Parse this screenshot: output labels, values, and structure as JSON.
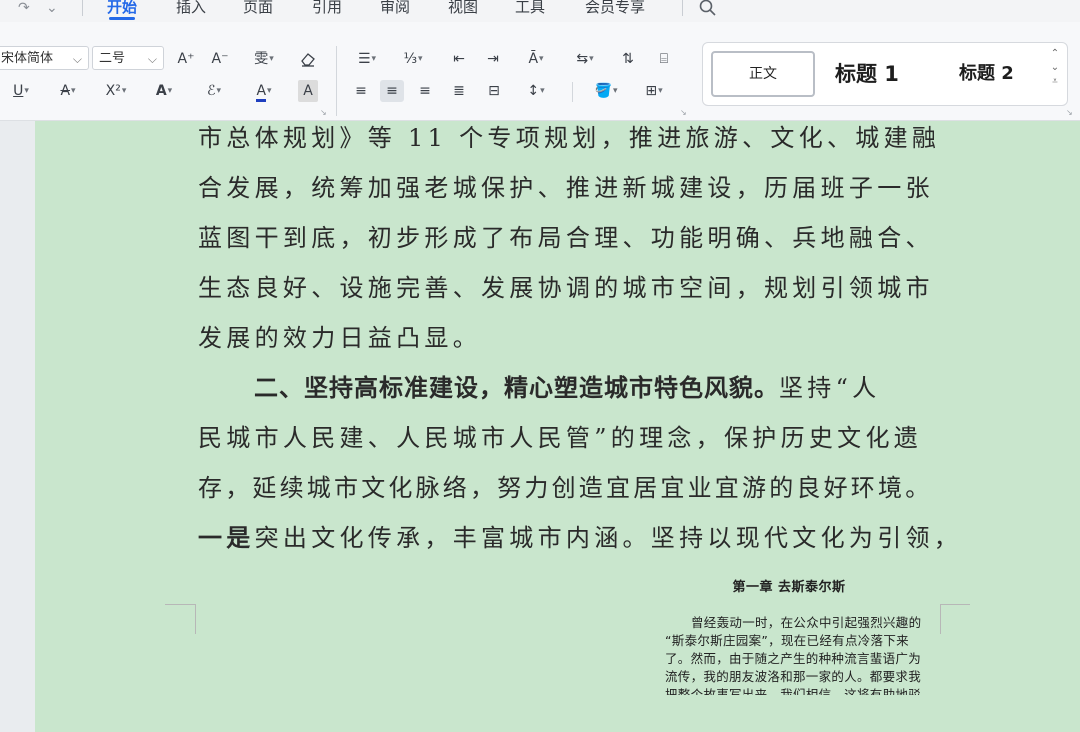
{
  "menubar": {
    "quick_access": [
      "↷",
      "⌄"
    ],
    "tabs": [
      {
        "label": "开始",
        "active": true
      },
      {
        "label": "插入"
      },
      {
        "label": "页面"
      },
      {
        "label": "引用"
      },
      {
        "label": "审阅"
      },
      {
        "label": "视图"
      },
      {
        "label": "工具"
      },
      {
        "label": "会员专享"
      }
    ]
  },
  "ribbon": {
    "font_name": "宋体简体",
    "font_size": "二号",
    "row1": {
      "grow_font": "A⁺",
      "shrink_font": "A⁻",
      "phonetic": "a̐",
      "clear_format": "⌫"
    },
    "styles": {
      "normal": "正文",
      "heading1": "标题 1",
      "heading2": "标题 2"
    },
    "colors": {
      "accent": "#2469e8",
      "font_color_bar": "#1f3fbf",
      "page_background": "#c9e6cd"
    }
  },
  "document": {
    "lines": [
      "市总体规划》等 11 个专项规划，推进旅游、文化、城建融",
      "合发展，统筹加强老城保护、推进新城建设，历届班子一张",
      "蓝图干到底，初步形成了布局合理、功能明确、兵地融合、",
      "生态良好、设施完善、发展协调的城市空间，规划引领城市",
      "发展的效力日益凸显。",
      "二、坚持高标准建设，精心塑造城市特色风貌。",
      "坚持“人",
      "民城市人民建、人民城市人民管”的理念，保护历史文化遗",
      "存，延续城市文化脉络，努力创造宜居宜业宜游的良好环境。",
      "一是",
      "突出文化传承，丰富城市内涵。坚持以现代文化为引领，"
    ],
    "embedded_image": {
      "title": "第一章 去斯泰尔斯",
      "lines": [
        "曾经轰动一时，在公众中引起强烈兴趣的",
        "“斯泰尔斯庄园案”，现在已经有点冷落下来",
        "了。然而，由于随之产生的种种流言蜚语广为",
        "流传，我的朋友波洛和那一家的人。都要求我",
        "把整个故事写出来，我们相信，这将有助地驳"
      ]
    }
  }
}
